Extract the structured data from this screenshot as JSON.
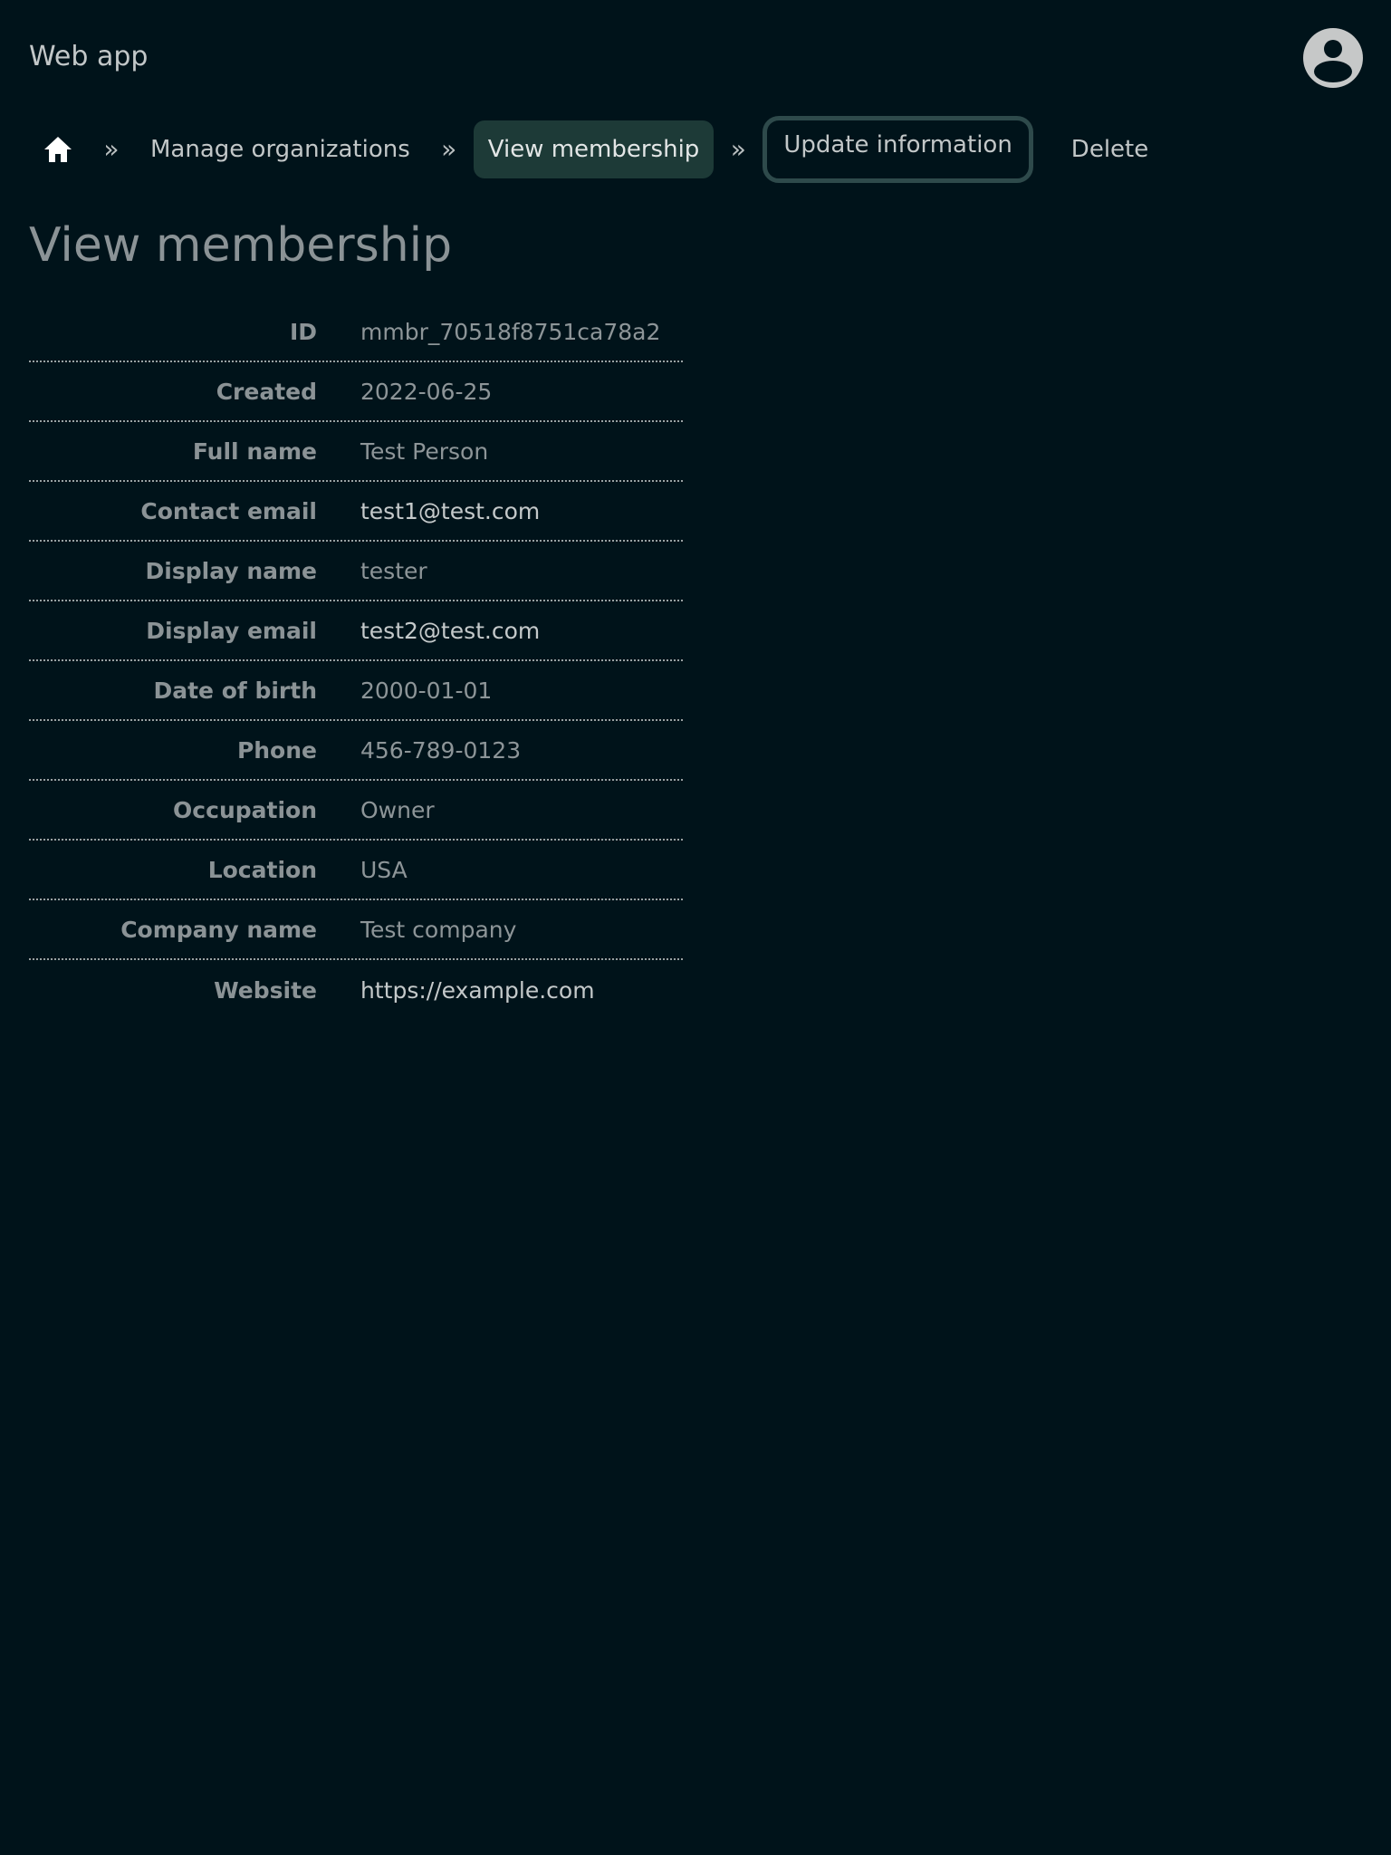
{
  "header": {
    "app_title": "Web app",
    "avatar_icon": "user-circle-icon"
  },
  "breadcrumb": {
    "home_icon": "home-icon",
    "separator": "»",
    "items": [
      {
        "label": "Manage organizations"
      },
      {
        "label": "View membership"
      },
      {
        "label": "Update information"
      },
      {
        "label": "Delete"
      }
    ]
  },
  "page": {
    "title": "View membership"
  },
  "details": [
    {
      "label": "ID",
      "value": "mmbr_70518f8751ca78a2"
    },
    {
      "label": "Created",
      "value": "2022-06-25"
    },
    {
      "label": "Full name",
      "value": "Test Person"
    },
    {
      "label": "Contact email",
      "value": "test1@test.com"
    },
    {
      "label": "Display name",
      "value": "tester"
    },
    {
      "label": "Display email",
      "value": "test2@test.com"
    },
    {
      "label": "Date of birth",
      "value": "2000-01-01"
    },
    {
      "label": "Phone",
      "value": "456-789-0123"
    },
    {
      "label": "Occupation",
      "value": "Owner"
    },
    {
      "label": "Location",
      "value": "USA"
    },
    {
      "label": "Company name",
      "value": "Test company"
    },
    {
      "label": "Website",
      "value": "https://example.com"
    }
  ],
  "colors": {
    "background": "#00131a",
    "active_crumb": "#1d3a37",
    "focus_ring": "#2e4a4b"
  }
}
